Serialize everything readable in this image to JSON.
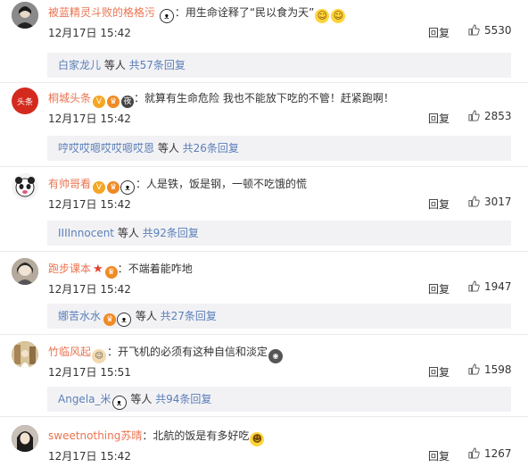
{
  "comments": [
    {
      "username": "被蓝精灵斗败的格格污",
      "sep": "：",
      "text": "用生命诠释了“民以食为天”",
      "time": "12月17日 15:42",
      "reply_label": "回复",
      "likes": "5530",
      "sub_user": "白家龙儿",
      "sub_mid": " 等人 ",
      "sub_count": "共57条回复",
      "avatar_color": "#6b6b6b"
    },
    {
      "username": "桐城头条",
      "sep": "：",
      "text": "就算有生命危险 我也不能放下吃的不管！赶紧跑啊！",
      "time": "12月17日 15:42",
      "reply_label": "回复",
      "likes": "2853",
      "sub_user": "哼哎哎嗯哎哎嗯哎恩",
      "sub_mid": " 等人 ",
      "sub_count": "共26条回复",
      "avatar_color": "#d42a1e",
      "avatar_text": "头条"
    },
    {
      "username": "有帅哥看",
      "sep": "：",
      "text": "人是铁，饭是钢，一顿不吃饿的慌",
      "time": "12月17日 15:42",
      "reply_label": "回复",
      "likes": "3017",
      "sub_user": "IIIInnocent",
      "sub_mid": " 等人 ",
      "sub_count": "共92条回复",
      "avatar_color": "#f3f3f3"
    },
    {
      "username": "跑步课本",
      "sep": "：",
      "text": "不端着能咋地",
      "time": "12月17日 15:42",
      "reply_label": "回复",
      "likes": "1947",
      "sub_user": "娜苦水水",
      "sub_mid": " 等人 ",
      "sub_count": "共27条回复",
      "avatar_color": "#7d7166"
    },
    {
      "username": "竹临风起",
      "sep": "：",
      "text": "开飞机的必须有这种自信和淡定",
      "time": "12月17日 15:51",
      "reply_label": "回复",
      "likes": "1598",
      "sub_user": "Angela_米",
      "sub_mid": " 等人 ",
      "sub_count": "共94条回复",
      "avatar_color": "#c9b48a"
    },
    {
      "username": "sweetnothing苏晴",
      "sep": "：",
      "text": "北航的饭是有多好吃",
      "time": "12月17日 15:42",
      "reply_label": "回复",
      "likes": "1267",
      "avatar_color": "#3d3a3a"
    }
  ],
  "colors": {
    "username": "#eb7350",
    "link": "#5b7fb7",
    "sub_bg": "#f2f2f5"
  },
  "icons": {
    "thumb": "thumbs-up-icon",
    "panda": "panda-emoji-icon",
    "vip": "vip-badge-icon"
  }
}
